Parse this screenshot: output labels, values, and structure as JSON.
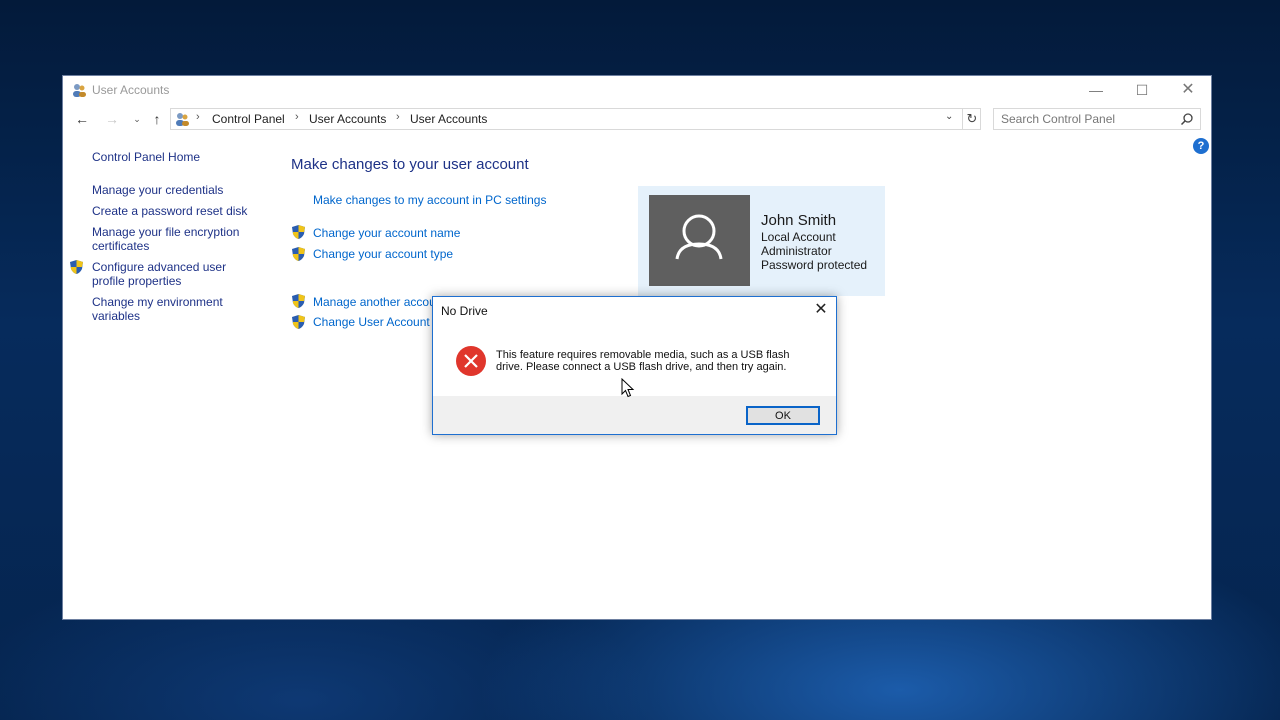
{
  "window": {
    "title": "User Accounts",
    "controls": {
      "minimize": "—",
      "maximize": "☐",
      "close": "✕"
    }
  },
  "navbar": {
    "back": "←",
    "forward": "→",
    "recent": "⌄",
    "up": "↑",
    "breadcrumb": [
      "Control Panel",
      "User Accounts",
      "User Accounts"
    ],
    "separator": "›",
    "dropdown": "⌄",
    "refresh": "↻",
    "search_placeholder": "Search Control Panel"
  },
  "help": "?",
  "sidebar": {
    "home": "Control Panel Home",
    "items": [
      {
        "label": "Manage your credentials"
      },
      {
        "label": "Create a password reset disk"
      },
      {
        "label": "Manage your file encryption certificates"
      },
      {
        "label": "Configure advanced user profile properties"
      },
      {
        "label": "Change my environment variables"
      }
    ]
  },
  "main": {
    "title": "Make changes to your user account",
    "links": [
      {
        "label": "Make changes to my account in PC settings"
      },
      {
        "label": "Change your account name"
      },
      {
        "label": "Change your account type"
      },
      {
        "label": "Manage another account"
      },
      {
        "label": "Change User Account Control settings"
      }
    ]
  },
  "account": {
    "name": "John Smith",
    "type": "Local Account",
    "role": "Administrator",
    "status": "Password protected"
  },
  "dialog": {
    "title": "No Drive",
    "close": "✕",
    "message": "This feature requires removable media, such as a USB flash drive. Please connect a USB flash drive, and then try again.",
    "ok_label": "OK"
  },
  "colors": {
    "link": "#0066cc",
    "nav_link": "#1e3287",
    "error": "#e0362c",
    "card_bg": "#e5f1fb",
    "accent": "#0a64c8"
  }
}
